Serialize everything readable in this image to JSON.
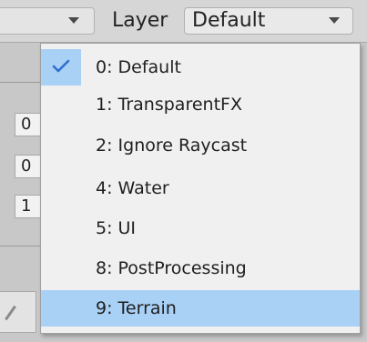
{
  "header": {
    "layer_label": "Layer",
    "layer_value": "Default"
  },
  "background": {
    "field_values": [
      "0",
      "0",
      "1"
    ]
  },
  "menu": {
    "items": [
      {
        "label": "0: Default",
        "checked": true,
        "highlighted": false
      },
      {
        "label": "1: TransparentFX",
        "checked": false,
        "highlighted": false
      },
      {
        "label": "2: Ignore Raycast",
        "checked": false,
        "highlighted": false
      },
      {
        "label": "4: Water",
        "checked": false,
        "highlighted": false
      },
      {
        "label": "5: UI",
        "checked": false,
        "highlighted": false
      },
      {
        "label": "8: PostProcessing",
        "checked": false,
        "highlighted": false
      },
      {
        "label": "9: Terrain",
        "checked": false,
        "highlighted": true
      }
    ]
  },
  "colors": {
    "highlight": "#a9d0f5",
    "check": "#2f6fd0"
  },
  "icons": {
    "dropdown_arrow": "chevron-down-icon",
    "check": "check-icon",
    "edit": "pencil-icon"
  }
}
